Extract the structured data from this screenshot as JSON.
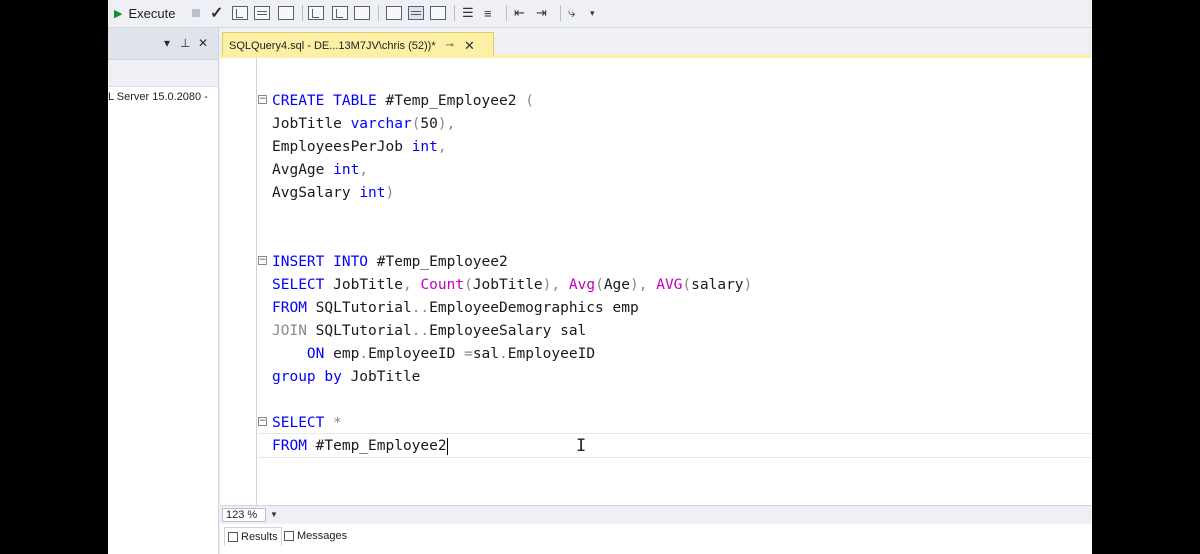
{
  "toolbar": {
    "execute_label": "Execute",
    "icons": [
      "stop-icon",
      "parse-icon",
      "display-plan-icon",
      "query-options-icon",
      "results-text-icon",
      "results-grid-icon",
      "results-file-icon",
      "include-plan-icon",
      "live-stats-icon",
      "client-stats-icon",
      "comment-icon",
      "uncomment-icon",
      "decrease-indent-icon",
      "increase-indent-icon",
      "specify-values-icon"
    ]
  },
  "left_panel": {
    "controls": [
      "▾",
      "⊥",
      "✕"
    ],
    "server_text": "L Server 15.0.2080 -"
  },
  "tab": {
    "label": "SQLQuery4.sql - DE...13M7JV\\chris (52))*",
    "pin": "⊸",
    "close": "✕"
  },
  "editor": {
    "lines": [
      {
        "fold": "−",
        "tokens": [
          [
            "kw",
            "CREATE TABLE"
          ],
          [
            "",
            "#Temp_Employee2 "
          ],
          [
            "gr",
            "("
          ]
        ]
      },
      {
        "tokens": [
          [
            "",
            "JobTitle "
          ],
          [
            "kw",
            "varchar"
          ],
          [
            "gr",
            "("
          ],
          [
            "",
            "50"
          ],
          [
            "gr",
            "),"
          ]
        ]
      },
      {
        "tokens": [
          [
            "",
            "EmployeesPerJob "
          ],
          [
            "kw",
            "int"
          ],
          [
            "gr",
            ","
          ]
        ]
      },
      {
        "tokens": [
          [
            "",
            "AvgAge "
          ],
          [
            "kw",
            "int"
          ],
          [
            "gr",
            ","
          ]
        ]
      },
      {
        "tokens": [
          [
            "",
            "AvgSalary "
          ],
          [
            "kw",
            "int"
          ],
          [
            "gr",
            ")"
          ]
        ]
      },
      {
        "tokens": []
      },
      {
        "tokens": []
      },
      {
        "fold": "−",
        "tokens": [
          [
            "kw",
            "INSERT INTO"
          ],
          [
            "",
            "#Temp_Employee2"
          ]
        ]
      },
      {
        "tokens": [
          [
            "kw",
            "SELECT"
          ],
          [
            "",
            "JobTitle"
          ],
          [
            "gr",
            ", "
          ],
          [
            "fn",
            "Count"
          ],
          [
            "gr",
            "("
          ],
          [
            "",
            "JobTitle"
          ],
          [
            "gr",
            "), "
          ],
          [
            "fn",
            "Avg"
          ],
          [
            "gr",
            "("
          ],
          [
            "",
            "Age"
          ],
          [
            "gr",
            "), "
          ],
          [
            "fn",
            "AVG"
          ],
          [
            "gr",
            "("
          ],
          [
            "",
            "salary"
          ],
          [
            "gr",
            ")"
          ]
        ]
      },
      {
        "tokens": [
          [
            "kw",
            "FROM"
          ],
          [
            "",
            "SQLTutorial"
          ],
          [
            "gr",
            ".."
          ],
          [
            "",
            "EmployeeDemographics emp"
          ]
        ]
      },
      {
        "tokens": [
          [
            "gr",
            "JOIN"
          ],
          [
            "",
            "SQLTutorial"
          ],
          [
            "gr",
            ".."
          ],
          [
            "",
            "EmployeeSalary sal"
          ]
        ]
      },
      {
        "tokens": [
          [
            "",
            "    "
          ],
          [
            "kw",
            "ON"
          ],
          [
            "",
            "emp"
          ],
          [
            "gr",
            "."
          ],
          [
            "",
            "EmployeeID "
          ],
          [
            "gr",
            "="
          ],
          [
            "",
            "sal"
          ],
          [
            "gr",
            "."
          ],
          [
            "",
            "EmployeeID"
          ]
        ]
      },
      {
        "tokens": [
          [
            "kw",
            "group by"
          ],
          [
            "",
            "JobTitle"
          ]
        ]
      },
      {
        "tokens": []
      },
      {
        "fold": "−",
        "tokens": [
          [
            "kw",
            "SELECT"
          ],
          [
            "gr",
            "*"
          ]
        ]
      },
      {
        "tokens": [
          [
            "kw",
            "FROM"
          ],
          [
            "",
            "#Temp_Employee2"
          ]
        ],
        "caret": true
      }
    ]
  },
  "zoom": {
    "value": "123 %"
  },
  "results": {
    "tabs": [
      "Results",
      "Messages"
    ]
  }
}
